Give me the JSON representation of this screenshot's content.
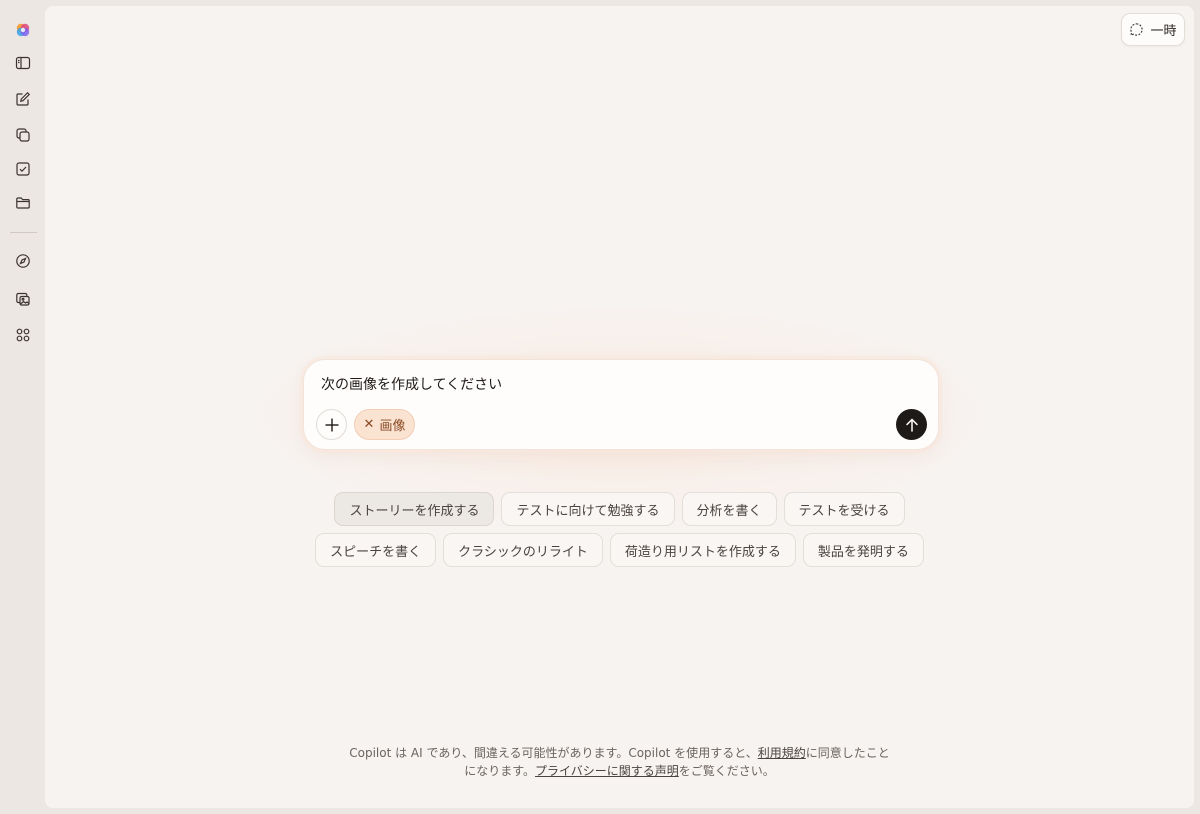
{
  "sidebar": {
    "items": [
      {
        "name": "copilot-logo-icon"
      },
      {
        "name": "sidebar-toggle-icon"
      },
      {
        "name": "new-chat-icon"
      },
      {
        "name": "pages-icon"
      },
      {
        "name": "tasks-icon"
      },
      {
        "name": "folder-icon"
      },
      {
        "name": "discover-icon"
      },
      {
        "name": "image-gallery-icon"
      },
      {
        "name": "apps-grid-icon"
      }
    ]
  },
  "header": {
    "temp_chat_label": "一時"
  },
  "composer": {
    "text": "次の画像を作成してください",
    "chip_remove": "✕",
    "chip_label": "画像"
  },
  "suggestions": {
    "row1": [
      "ストーリーを作成する",
      "テストに向けて勉強する",
      "分析を書く",
      "テストを受ける"
    ],
    "row2": [
      "スピーチを書く",
      "クラシックのリライト",
      "荷造り用リストを作成する",
      "製品を発明する"
    ]
  },
  "disclaimer": {
    "line1_prefix": "Copilot は AI であり、間違える可能性があります。Copilot を使用すると、",
    "terms_link": "利用規約",
    "line1_suffix": "に同意したこと",
    "line2_prefix": "になります。",
    "privacy_link": "プライバシーに関する声明",
    "line2_suffix": "をご覧ください。"
  },
  "colors": {
    "background": "#ece7e3",
    "panel": "#f7f3f0",
    "chip_bg": "#fbe3d2",
    "send_button": "#1d1a18"
  }
}
